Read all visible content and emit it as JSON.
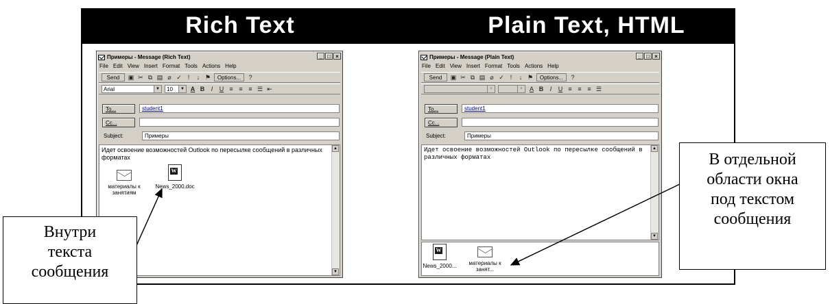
{
  "header": {
    "left_title": "Rich Text",
    "right_title": "Plain Text, HTML"
  },
  "left_window": {
    "title": "Примеры - Message (Rich Text)",
    "menu": [
      "File",
      "Edit",
      "View",
      "Insert",
      "Format",
      "Tools",
      "Actions",
      "Help"
    ],
    "toolbar1": {
      "send": "Send",
      "options": "Options..."
    },
    "toolbar2": {
      "font": "Arial",
      "size": "10"
    },
    "to_button": "To...",
    "to_value": "student1",
    "cc_button": "Cc...",
    "cc_value": "",
    "subject_label": "Subject:",
    "subject_value": "Примеры",
    "body_text": "Идет освоение возможностей Outlook по пересылке сообщений в различных форматах",
    "attachments": [
      {
        "icon": "envelope-icon",
        "label": "материалы к занятиям"
      },
      {
        "icon": "word-doc-icon",
        "label": "News_2000.doc"
      }
    ]
  },
  "right_window": {
    "title": "Примеры - Message (Plain Text)",
    "menu": [
      "File",
      "Edit",
      "View",
      "Insert",
      "Format",
      "Tools",
      "Actions",
      "Help"
    ],
    "toolbar1": {
      "send": "Send",
      "options": "Options..."
    },
    "to_button": "To...",
    "to_value": "student1",
    "cc_button": "Cc...",
    "cc_value": "",
    "subject_label": "Subject:",
    "subject_value": "Примеры",
    "body_text": "Идет освоение возможностей Outlook по пересылке сообщений в различных форматах",
    "attachments": [
      {
        "icon": "word-doc-icon",
        "label": "News_2000..."
      },
      {
        "icon": "envelope-icon",
        "label": "материалы к занят..."
      }
    ]
  },
  "callouts": {
    "left": "Внутри\nтекста\nсообщения",
    "right": "В отдельной\nобласти окна\nпод текстом\nсообщения"
  }
}
